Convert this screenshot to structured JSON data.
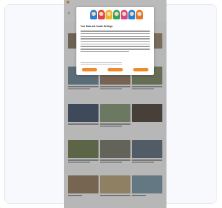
{
  "colors": {
    "accent": "#f08a2c",
    "overlay": "rgba(90,90,90,0.42)"
  },
  "header": {
    "back_icon": "back-arrow-icon"
  },
  "consent": {
    "title": "Your Data and Cookie Settings",
    "accept_label": "",
    "reject_label": "",
    "settings_label": ""
  },
  "videos": [
    {
      "color": "#5c7a8e"
    },
    {
      "color": "#8a6a4e"
    },
    {
      "color": "#6e7a52"
    },
    {
      "color": "#3b4e68"
    },
    {
      "color": "#8c8a6a"
    },
    {
      "color": "#4a3a2a"
    },
    {
      "color": "#2a3d5a"
    },
    {
      "color": "#7a8e6a"
    },
    {
      "color": "#5a4632"
    },
    {
      "color": "#5e6e3a"
    },
    {
      "color": "#6a6a5a"
    },
    {
      "color": "#4a5e6e"
    },
    {
      "color": "#8a6e4a"
    },
    {
      "color": "#b59a6a"
    },
    {
      "color": "#6a8ea0"
    }
  ]
}
